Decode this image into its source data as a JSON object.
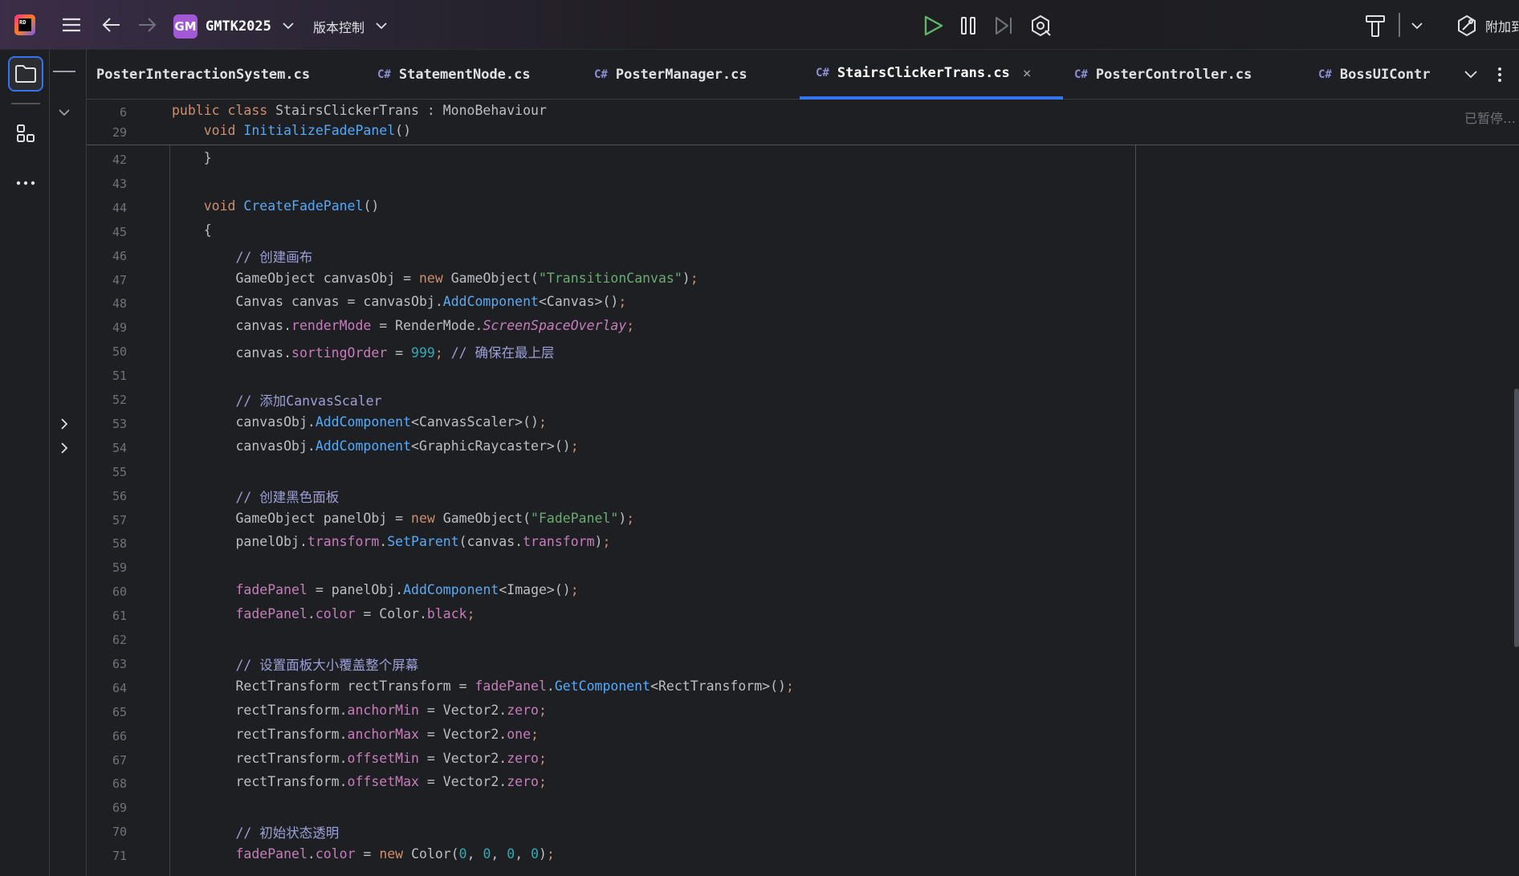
{
  "titlebar": {
    "project_badge": "GM",
    "project_name": "GMTK2025",
    "vcs_label": "版本控制",
    "attach_label": "附加到"
  },
  "tabs": [
    {
      "label": "PosterInteractionSystem.cs",
      "lang": "",
      "active": false
    },
    {
      "label": "StatementNode.cs",
      "lang": "C#",
      "active": false
    },
    {
      "label": "PosterManager.cs",
      "lang": "C#",
      "active": false
    },
    {
      "label": "StairsClickerTrans.cs",
      "lang": "C#",
      "active": true
    },
    {
      "label": "PosterController.cs",
      "lang": "C#",
      "active": false
    },
    {
      "label": "BossUIContr",
      "lang": "C#",
      "active": false
    }
  ],
  "editor": {
    "paused_label": "已暂停…",
    "sticky": [
      {
        "ln": "6",
        "parts": [
          [
            "kw",
            "public class "
          ],
          [
            "cls",
            "StairsClickerTrans : MonoBehaviour"
          ]
        ]
      },
      {
        "ln": "29",
        "parts": [
          [
            "dflt",
            "    "
          ],
          [
            "kw",
            "void "
          ],
          [
            "fnd",
            "InitializeFadePanel"
          ],
          [
            "dflt",
            "()"
          ]
        ]
      }
    ],
    "lines": [
      {
        "ln": "42",
        "parts": [
          [
            "dflt",
            "    }"
          ]
        ]
      },
      {
        "ln": "43",
        "parts": []
      },
      {
        "ln": "44",
        "parts": [
          [
            "dflt",
            "    "
          ],
          [
            "kw",
            "void "
          ],
          [
            "fnd",
            "CreateFadePanel"
          ],
          [
            "dflt",
            "()"
          ]
        ]
      },
      {
        "ln": "45",
        "parts": [
          [
            "dflt",
            "    {"
          ]
        ]
      },
      {
        "ln": "46",
        "parts": [
          [
            "dflt",
            "        "
          ],
          [
            "cmz",
            "// 创建画布"
          ]
        ]
      },
      {
        "ln": "47",
        "parts": [
          [
            "dflt",
            "        GameObject canvasObj = "
          ],
          [
            "kw",
            "new "
          ],
          [
            "dflt",
            "GameObject("
          ],
          [
            "str",
            "\"TransitionCanvas\""
          ],
          [
            "dflt",
            ")"
          ],
          [
            "semi",
            ";"
          ]
        ]
      },
      {
        "ln": "48",
        "parts": [
          [
            "dflt",
            "        Canvas canvas = canvasObj."
          ],
          [
            "mth",
            "AddComponent"
          ],
          [
            "dflt",
            "<Canvas>()"
          ],
          [
            "semi",
            ";"
          ]
        ]
      },
      {
        "ln": "49",
        "parts": [
          [
            "dflt",
            "        canvas."
          ],
          [
            "prop",
            "renderMode"
          ],
          [
            "dflt",
            " = RenderMode."
          ],
          [
            "ital",
            "ScreenSpaceOverlay"
          ],
          [
            "semi",
            ";"
          ]
        ]
      },
      {
        "ln": "50",
        "parts": [
          [
            "dflt",
            "        canvas."
          ],
          [
            "prop",
            "sortingOrder"
          ],
          [
            "dflt",
            " = "
          ],
          [
            "num",
            "999"
          ],
          [
            "semi",
            "; "
          ],
          [
            "cmz",
            "// 确保在最上层"
          ]
        ]
      },
      {
        "ln": "51",
        "parts": []
      },
      {
        "ln": "52",
        "parts": [
          [
            "dflt",
            "        "
          ],
          [
            "cmz",
            "// 添加CanvasScaler"
          ]
        ]
      },
      {
        "ln": "53",
        "parts": [
          [
            "dflt",
            "        canvasObj."
          ],
          [
            "mth",
            "AddComponent"
          ],
          [
            "dflt",
            "<CanvasScaler>()"
          ],
          [
            "semi",
            ";"
          ]
        ]
      },
      {
        "ln": "54",
        "parts": [
          [
            "dflt",
            "        canvasObj."
          ],
          [
            "mth",
            "AddComponent"
          ],
          [
            "dflt",
            "<GraphicRaycaster>()"
          ],
          [
            "semi",
            ";"
          ]
        ]
      },
      {
        "ln": "55",
        "parts": []
      },
      {
        "ln": "56",
        "parts": [
          [
            "dflt",
            "        "
          ],
          [
            "cmz",
            "// 创建黑色面板"
          ]
        ]
      },
      {
        "ln": "57",
        "parts": [
          [
            "dflt",
            "        GameObject panelObj = "
          ],
          [
            "kw",
            "new "
          ],
          [
            "dflt",
            "GameObject("
          ],
          [
            "str",
            "\"FadePanel\""
          ],
          [
            "dflt",
            ")"
          ],
          [
            "semi",
            ";"
          ]
        ]
      },
      {
        "ln": "58",
        "parts": [
          [
            "dflt",
            "        panelObj."
          ],
          [
            "prop",
            "transform"
          ],
          [
            "dflt",
            "."
          ],
          [
            "mth",
            "SetParent"
          ],
          [
            "dflt",
            "(canvas."
          ],
          [
            "prop",
            "transform"
          ],
          [
            "dflt",
            ")"
          ],
          [
            "semi",
            ";"
          ]
        ]
      },
      {
        "ln": "59",
        "parts": []
      },
      {
        "ln": "60",
        "parts": [
          [
            "dflt",
            "        "
          ],
          [
            "field",
            "fadePanel"
          ],
          [
            "dflt",
            " = panelObj."
          ],
          [
            "mth",
            "AddComponent"
          ],
          [
            "dflt",
            "<Image>()"
          ],
          [
            "semi",
            ";"
          ]
        ]
      },
      {
        "ln": "61",
        "parts": [
          [
            "dflt",
            "        "
          ],
          [
            "field",
            "fadePanel"
          ],
          [
            "dflt",
            "."
          ],
          [
            "prop",
            "color"
          ],
          [
            "dflt",
            " = Color."
          ],
          [
            "prop",
            "black"
          ],
          [
            "semi",
            ";"
          ]
        ]
      },
      {
        "ln": "62",
        "parts": []
      },
      {
        "ln": "63",
        "parts": [
          [
            "dflt",
            "        "
          ],
          [
            "cmz",
            "// 设置面板大小覆盖整个屏幕"
          ]
        ]
      },
      {
        "ln": "64",
        "parts": [
          [
            "dflt",
            "        RectTransform rectTransform = "
          ],
          [
            "field",
            "fadePanel"
          ],
          [
            "dflt",
            "."
          ],
          [
            "mth",
            "GetComponent"
          ],
          [
            "dflt",
            "<RectTransform>()"
          ],
          [
            "semi",
            ";"
          ]
        ]
      },
      {
        "ln": "65",
        "parts": [
          [
            "dflt",
            "        rectTransform."
          ],
          [
            "prop",
            "anchorMin"
          ],
          [
            "dflt",
            " = Vector2."
          ],
          [
            "prop",
            "zero"
          ],
          [
            "semi",
            ";"
          ]
        ]
      },
      {
        "ln": "66",
        "parts": [
          [
            "dflt",
            "        rectTransform."
          ],
          [
            "prop",
            "anchorMax"
          ],
          [
            "dflt",
            " = Vector2."
          ],
          [
            "prop",
            "one"
          ],
          [
            "semi",
            ";"
          ]
        ]
      },
      {
        "ln": "67",
        "parts": [
          [
            "dflt",
            "        rectTransform."
          ],
          [
            "prop",
            "offsetMin"
          ],
          [
            "dflt",
            " = Vector2."
          ],
          [
            "prop",
            "zero"
          ],
          [
            "semi",
            ";"
          ]
        ]
      },
      {
        "ln": "68",
        "parts": [
          [
            "dflt",
            "        rectTransform."
          ],
          [
            "prop",
            "offsetMax"
          ],
          [
            "dflt",
            " = Vector2."
          ],
          [
            "prop",
            "zero"
          ],
          [
            "semi",
            ";"
          ]
        ]
      },
      {
        "ln": "69",
        "parts": []
      },
      {
        "ln": "70",
        "parts": [
          [
            "dflt",
            "        "
          ],
          [
            "cmz",
            "// 初始状态透明"
          ]
        ]
      },
      {
        "ln": "71",
        "parts": [
          [
            "dflt",
            "        "
          ],
          [
            "field",
            "fadePanel"
          ],
          [
            "dflt",
            "."
          ],
          [
            "prop",
            "color"
          ],
          [
            "dflt",
            " = "
          ],
          [
            "kw",
            "new "
          ],
          [
            "dflt",
            "Color("
          ],
          [
            "num",
            "0"
          ],
          [
            "dflt",
            ", "
          ],
          [
            "num",
            "0"
          ],
          [
            "dflt",
            ", "
          ],
          [
            "num",
            "0"
          ],
          [
            "dflt",
            ", "
          ],
          [
            "num",
            "0"
          ],
          [
            "dflt",
            ")"
          ],
          [
            "semi",
            ";"
          ]
        ]
      }
    ]
  },
  "colors": {
    "accent": "#3574f0",
    "run_green": "#5fb865",
    "project_badge": "#a359d6"
  }
}
